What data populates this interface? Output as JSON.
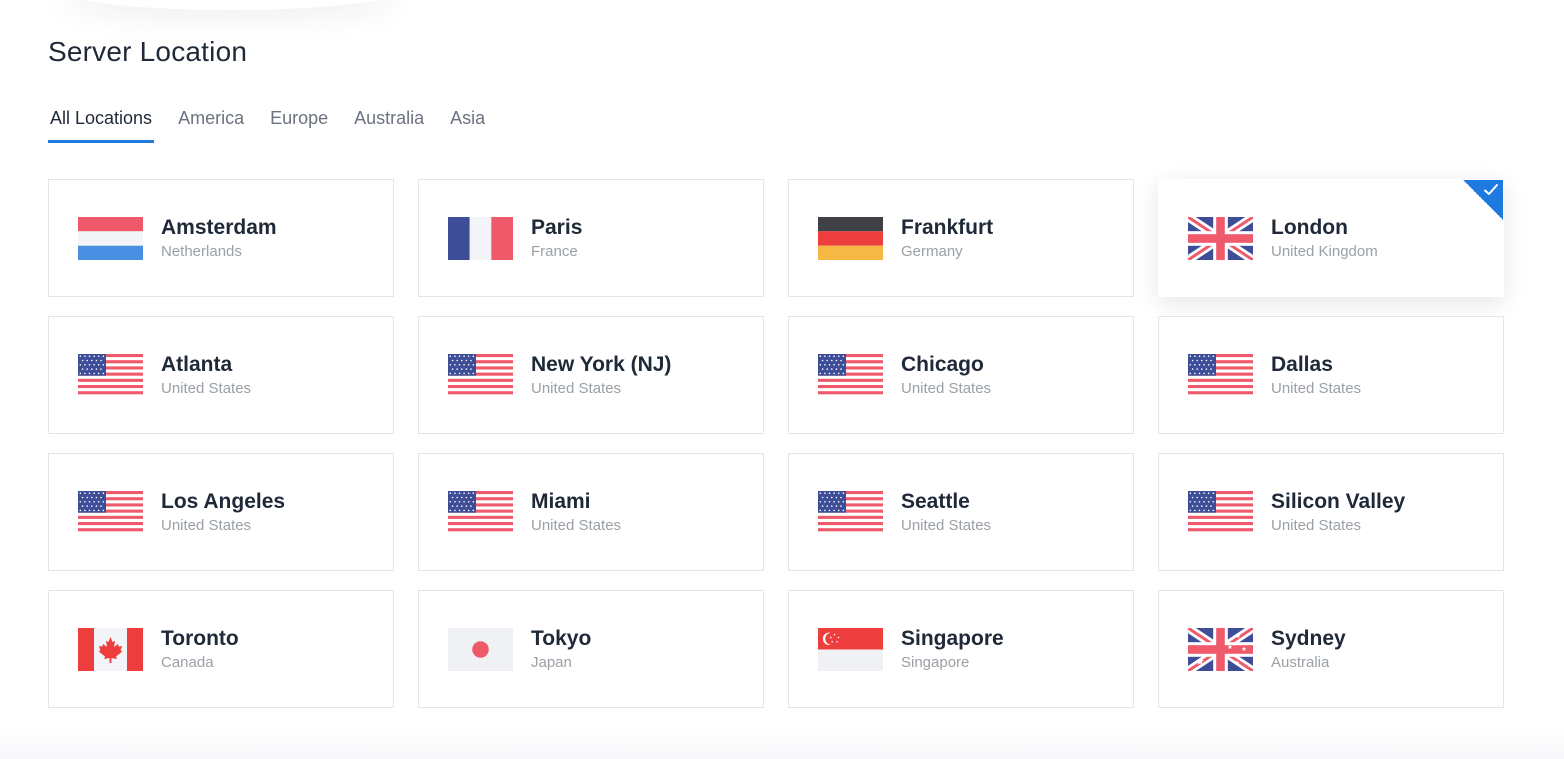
{
  "title": "Server Location",
  "tabs": [
    {
      "label": "All Locations",
      "active": true
    },
    {
      "label": "America",
      "active": false
    },
    {
      "label": "Europe",
      "active": false
    },
    {
      "label": "Australia",
      "active": false
    },
    {
      "label": "Asia",
      "active": false
    }
  ],
  "colors": {
    "accent": "#1f7ae0",
    "flag_red": "#ee5a6a",
    "flag_blue": "#3d4d98"
  },
  "locations": [
    {
      "city": "Amsterdam",
      "country": "Netherlands",
      "flag": "nl-flag-icon",
      "selected": false
    },
    {
      "city": "Paris",
      "country": "France",
      "flag": "fr-flag-icon",
      "selected": false
    },
    {
      "city": "Frankfurt",
      "country": "Germany",
      "flag": "de-flag-icon",
      "selected": false
    },
    {
      "city": "London",
      "country": "United Kingdom",
      "flag": "gb-flag-icon",
      "selected": true
    },
    {
      "city": "Atlanta",
      "country": "United States",
      "flag": "us-flag-icon",
      "selected": false
    },
    {
      "city": "New York (NJ)",
      "country": "United States",
      "flag": "us-flag-icon",
      "selected": false
    },
    {
      "city": "Chicago",
      "country": "United States",
      "flag": "us-flag-icon",
      "selected": false
    },
    {
      "city": "Dallas",
      "country": "United States",
      "flag": "us-flag-icon",
      "selected": false
    },
    {
      "city": "Los Angeles",
      "country": "United States",
      "flag": "us-flag-icon",
      "selected": false
    },
    {
      "city": "Miami",
      "country": "United States",
      "flag": "us-flag-icon",
      "selected": false
    },
    {
      "city": "Seattle",
      "country": "United States",
      "flag": "us-flag-icon",
      "selected": false
    },
    {
      "city": "Silicon Valley",
      "country": "United States",
      "flag": "us-flag-icon",
      "selected": false
    },
    {
      "city": "Toronto",
      "country": "Canada",
      "flag": "ca-flag-icon",
      "selected": false
    },
    {
      "city": "Tokyo",
      "country": "Japan",
      "flag": "jp-flag-icon",
      "selected": false
    },
    {
      "city": "Singapore",
      "country": "Singapore",
      "flag": "sg-flag-icon",
      "selected": false
    },
    {
      "city": "Sydney",
      "country": "Australia",
      "flag": "au-flag-icon",
      "selected": false
    }
  ]
}
